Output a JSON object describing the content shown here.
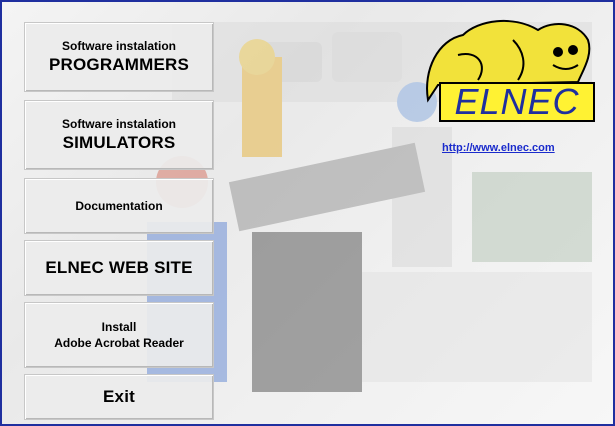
{
  "buttons": {
    "programmers": {
      "line1": "Software instalation",
      "line2": "PROGRAMMERS"
    },
    "simulators": {
      "line1": "Software instalation",
      "line2": "SIMULATORS"
    },
    "documentation": {
      "label": "Documentation"
    },
    "website": {
      "label": "ELNEC WEB SITE"
    },
    "acrobat": {
      "line1": "Install",
      "line2": "Adobe Acrobat Reader"
    },
    "exit": {
      "label": "Exit"
    }
  },
  "logo": {
    "text": "ELNEC"
  },
  "link": {
    "text": "http://www.elnec.com"
  },
  "colors": {
    "border": "#1f2f9f",
    "logo_yellow": "#fff233",
    "link": "#1a2bcc"
  }
}
